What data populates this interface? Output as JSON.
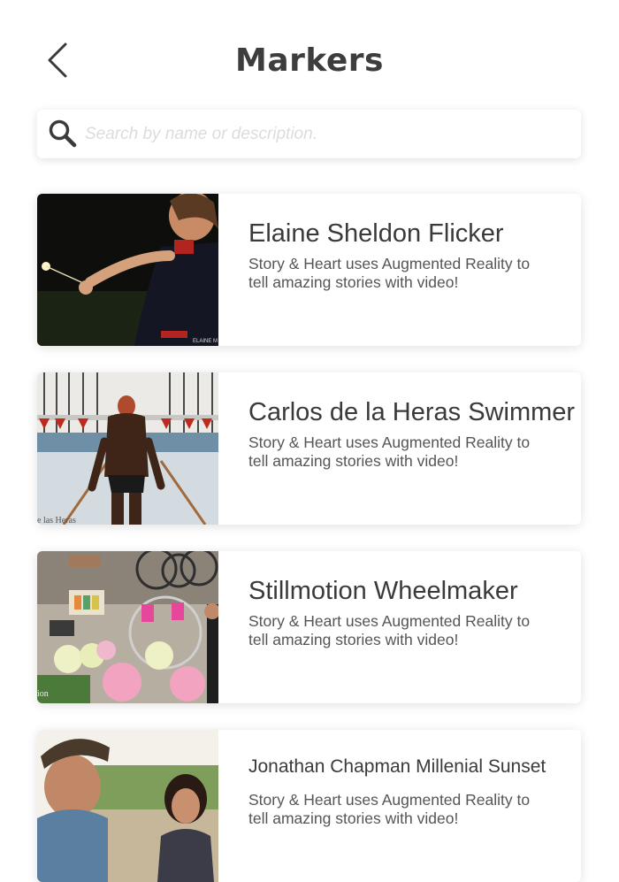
{
  "header": {
    "title": "Markers",
    "back_icon": "chevron-left-icon"
  },
  "search": {
    "placeholder": "Search by name or description.",
    "value": "",
    "icon": "search-icon"
  },
  "markers": [
    {
      "title": "Elaine Sheldon Flicker",
      "description": "Story & Heart uses Augmented Reality to tell amazing stories with video!",
      "thumb_caption": "ELAINE M"
    },
    {
      "title": "Carlos de la Heras Swimmer",
      "description": "Story & Heart uses Augmented Reality to tell amazing stories with video!",
      "thumb_caption": "e las Heras"
    },
    {
      "title": "Stillmotion Wheelmaker",
      "description": "Story & Heart uses Augmented Reality to tell amazing stories with video!",
      "thumb_caption": "ion"
    },
    {
      "title": "Jonathan Chapman Millenial Sunset",
      "description": "Story & Heart uses Augmented Reality to tell amazing stories with video!"
    }
  ],
  "colors": {
    "background": "#ffffff",
    "text": "#3c3c3c",
    "placeholder": "#dcdcdc"
  }
}
